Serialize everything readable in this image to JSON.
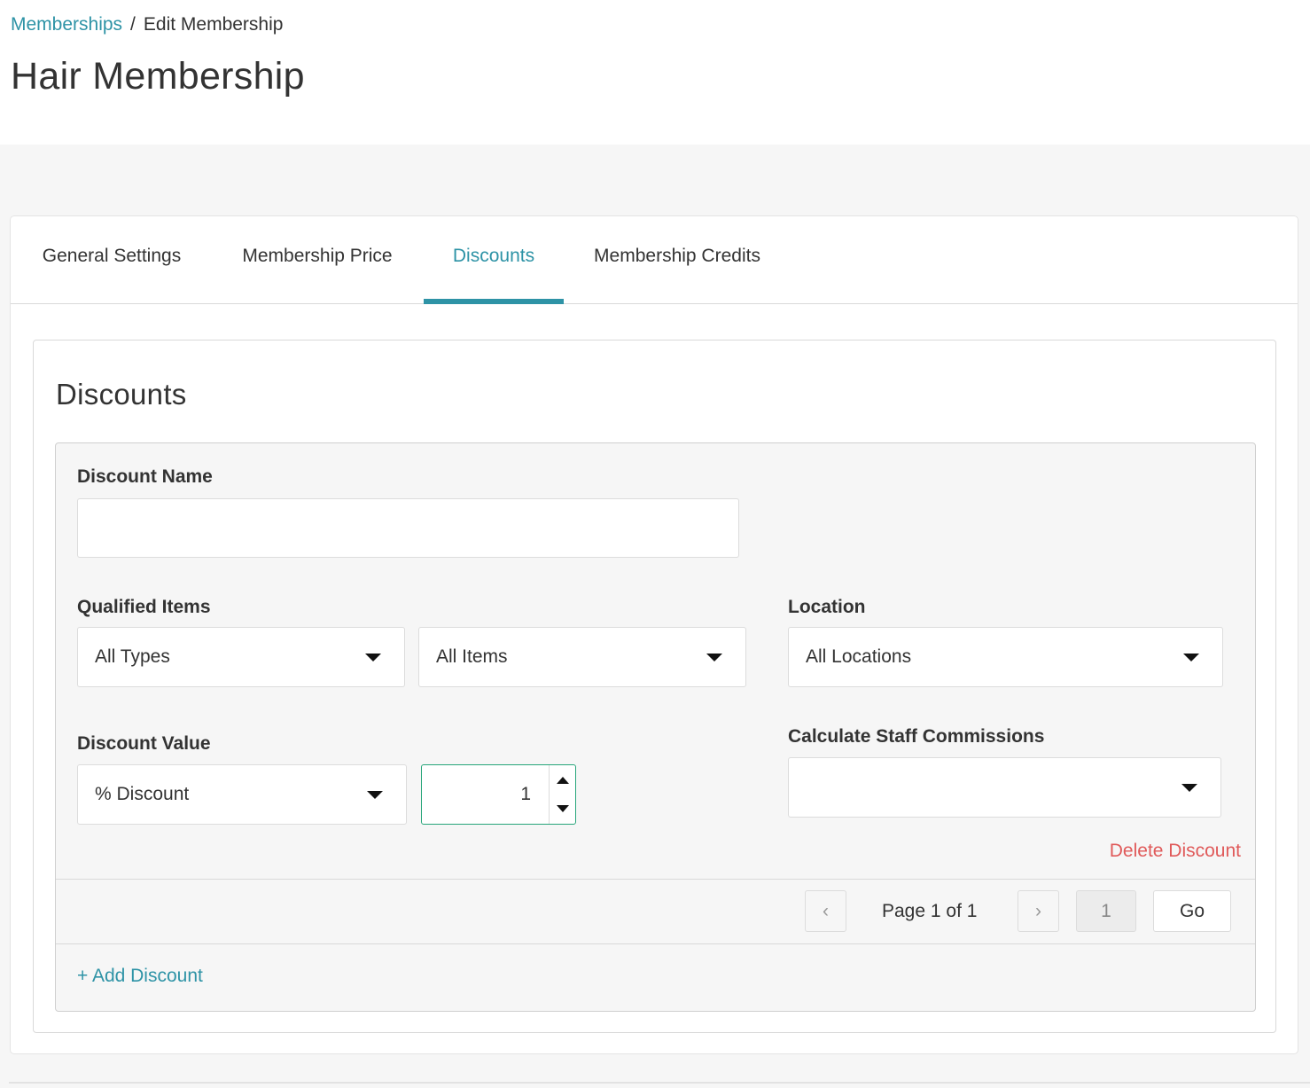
{
  "breadcrumb": {
    "parent": "Memberships",
    "separator": "/",
    "current": "Edit Membership"
  },
  "page_title": "Hair Membership",
  "tabs": [
    {
      "label": "General Settings",
      "active": false
    },
    {
      "label": "Membership Price",
      "active": false
    },
    {
      "label": "Discounts",
      "active": true
    },
    {
      "label": "Membership Credits",
      "active": false
    }
  ],
  "section": {
    "title": "Discounts"
  },
  "discount": {
    "name_label": "Discount Name",
    "name_value": "",
    "qualified_label": "Qualified Items",
    "type_select": "All Types",
    "items_select": "All Items",
    "location_label": "Location",
    "location_select": "All Locations",
    "value_label": "Discount Value",
    "value_type_select": "% Discount",
    "value_amount": "1",
    "commission_label": "Calculate Staff Commissions",
    "commission_select": "",
    "delete_label": "Delete Discount"
  },
  "pagination": {
    "prev": "‹",
    "page_text": "Page 1 of 1",
    "next": "›",
    "page_input": "1",
    "go_label": "Go"
  },
  "add_discount_label": "+ Add Discount",
  "colors": {
    "accent": "#2e93a6",
    "danger": "#e05a5a",
    "focus_border": "#27a57a"
  }
}
